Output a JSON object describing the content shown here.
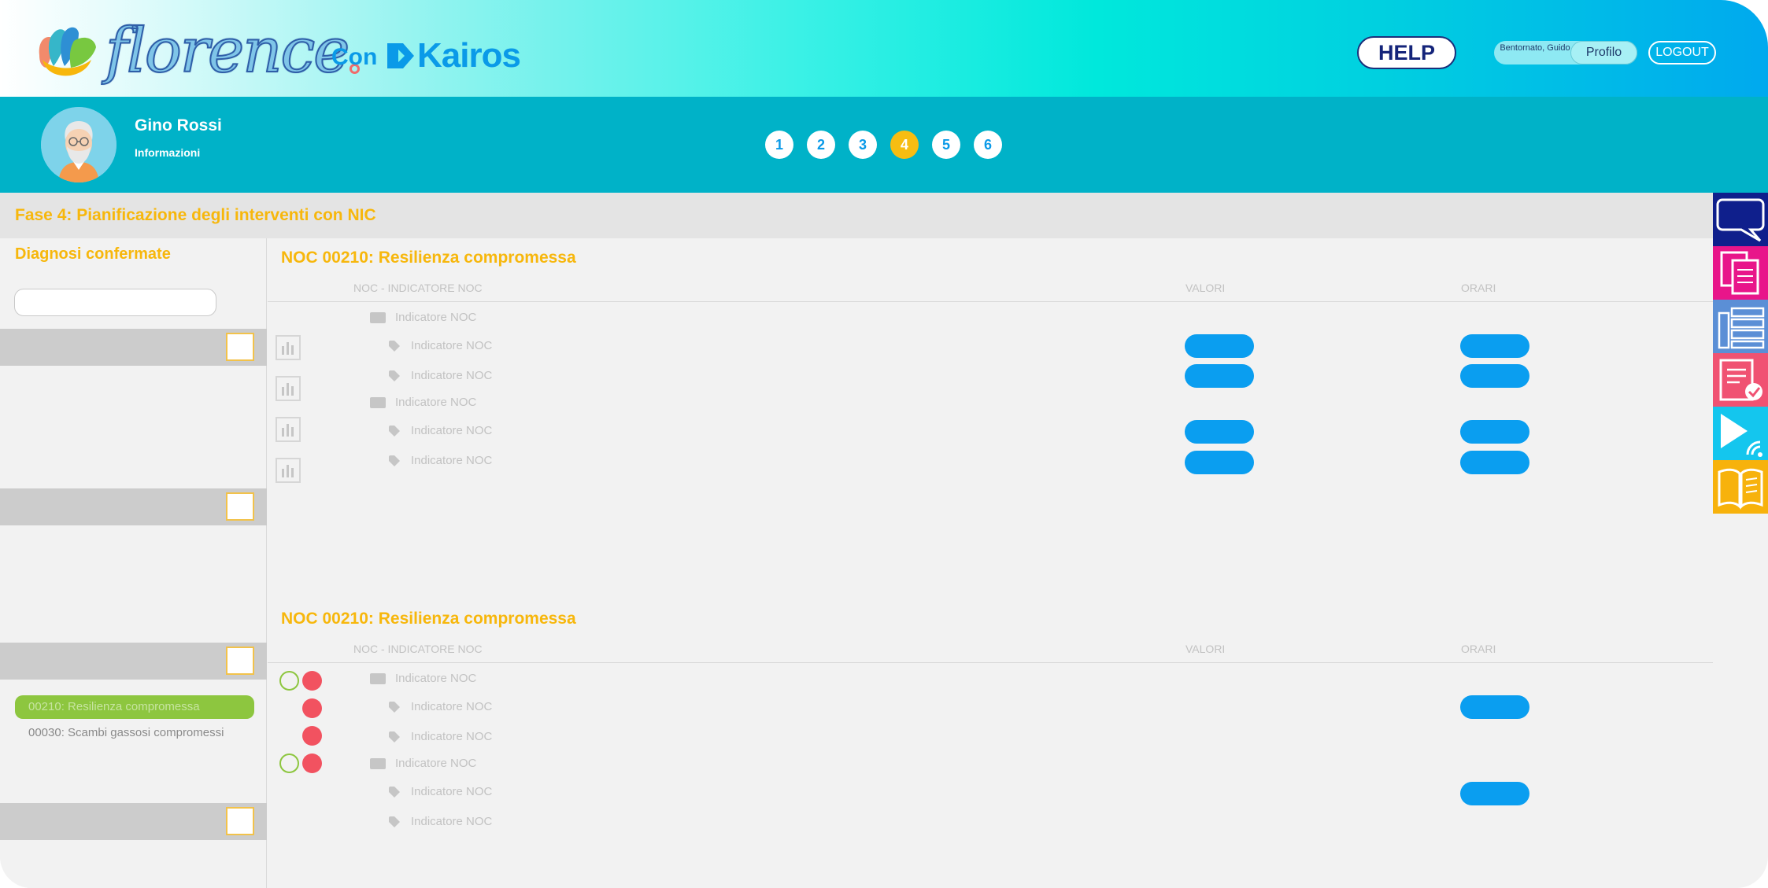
{
  "header": {
    "logo_text": "florence",
    "con_label": "Con",
    "kairos_label": "Kairos",
    "help_label": "HELP",
    "welcome_text": "Bentornato, Guido",
    "profile_label": "Profilo",
    "logout_label": "LOGOUT"
  },
  "patient": {
    "name": "Gino Rossi",
    "info_label": "Informazioni"
  },
  "steps": [
    "1",
    "2",
    "3",
    "4",
    "5",
    "6"
  ],
  "active_step": "4",
  "phase": {
    "title": "Fase 4: Pianificazione degli interventi con NIC"
  },
  "sidebar": {
    "title": "Diagnosi confermate",
    "search_placeholder": "",
    "items": [
      {
        "label": "00210: Resilienza compromessa",
        "active": true
      },
      {
        "label": "00030: Scambi gassosi compromessi",
        "active": false
      }
    ]
  },
  "panel1": {
    "title": "NOC 00210: Resilienza compromessa",
    "columns": {
      "indicator": "NOC - INDICATORE NOC",
      "values": "VALORI",
      "times": "ORARI"
    },
    "rows": [
      {
        "type": "folder",
        "label": "Indicatore NOC"
      },
      {
        "type": "tag",
        "label": "Indicatore NOC"
      },
      {
        "type": "tag",
        "label": "Indicatore NOC"
      },
      {
        "type": "folder",
        "label": "Indicatore NOC"
      },
      {
        "type": "tag",
        "label": "Indicatore NOC"
      },
      {
        "type": "tag",
        "label": "Indicatore NOC"
      }
    ]
  },
  "panel2": {
    "title": "NOC 00210: Resilienza compromessa",
    "columns": {
      "indicator": "NOC - INDICATORE NOC",
      "values": "VALORI",
      "times": "ORARI"
    },
    "rows": [
      {
        "type": "folder",
        "label": "Indicatore NOC"
      },
      {
        "type": "tag",
        "label": "Indicatore NOC"
      },
      {
        "type": "tag",
        "label": "Indicatore NOC"
      },
      {
        "type": "folder",
        "label": "Indicatore NOC"
      },
      {
        "type": "tag",
        "label": "Indicatore NOC"
      },
      {
        "type": "tag",
        "label": "Indicatore NOC"
      }
    ]
  },
  "toolbar": {
    "tools": [
      "chat-icon",
      "documents-icon",
      "library-icon",
      "checklist-icon",
      "media-icon",
      "book-icon"
    ]
  },
  "colors": {
    "accent": "#f7b70c",
    "primary_blue": "#0a9ef0",
    "patient_bar": "#00b2c8",
    "active_item": "#8dc63f",
    "alert_red": "#f25260"
  }
}
